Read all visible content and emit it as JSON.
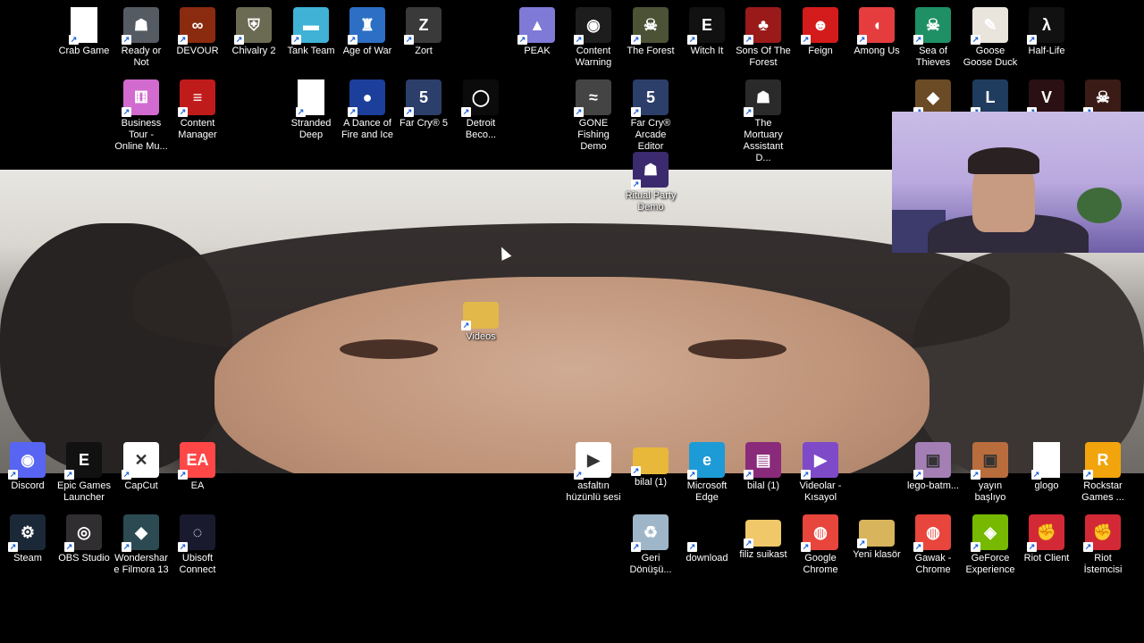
{
  "desktop": {
    "top_row": [
      {
        "label": "Crab Game",
        "icon": "file-icon",
        "color": "#ffffff"
      },
      {
        "label": "Ready or Not",
        "icon": "soldier-icon",
        "color": "#555b63"
      },
      {
        "label": "DEVOUR",
        "icon": "devour-icon",
        "color": "#8a2a0f"
      },
      {
        "label": "Chivalry 2",
        "icon": "shield-icon",
        "color": "#6b6a52"
      },
      {
        "label": "Tank Team",
        "icon": "tank-icon",
        "color": "#3fb2d6"
      },
      {
        "label": "Age of War",
        "icon": "castle-icon",
        "color": "#2c6fc4"
      },
      {
        "label": "Zort",
        "icon": "zort-icon",
        "color": "#3a3a3a"
      },
      {
        "label": "PEAK",
        "icon": "mountain-icon",
        "color": "#7e7ad6"
      },
      {
        "label": "Content Warning",
        "icon": "eye-warning-icon",
        "color": "#1d1d1d"
      },
      {
        "label": "The Forest",
        "icon": "skull-icon",
        "color": "#4c5236"
      },
      {
        "label": "Witch It",
        "icon": "epic-games-icon",
        "color": "#111111"
      },
      {
        "label": "Sons Of The Forest",
        "icon": "forest-icon",
        "color": "#9a1a1a"
      },
      {
        "label": "Feign",
        "icon": "feign-icon",
        "color": "#d41b1b"
      },
      {
        "label": "Among Us",
        "icon": "crewmate-icon",
        "color": "#e53d3d"
      },
      {
        "label": "Sea of Thieves",
        "icon": "skull-icon",
        "color": "#1f8f66"
      },
      {
        "label": "Goose Goose Duck",
        "icon": "goose-icon",
        "color": "#e9e4dc"
      },
      {
        "label": "Half-Life",
        "icon": "lambda-icon",
        "color": "#111111"
      }
    ],
    "second_row": [
      {
        "label": "Business Tour - Online Mu...",
        "icon": "dice-icon",
        "color": "#d26bd0"
      },
      {
        "label": "Content Manager",
        "icon": "cm-icon",
        "color": "#c01b1b"
      },
      {
        "label": "Stranded Deep",
        "icon": "file-icon",
        "color": "#ffffff"
      },
      {
        "label": "A Dance of Fire and Ice",
        "icon": "planets-icon",
        "color": "#1b3f9a"
      },
      {
        "label": "Far Cry® 5",
        "icon": "farcry-icon",
        "color": "#2c3e6a"
      },
      {
        "label": "Detroit Beco...",
        "icon": "ring-icon",
        "color": "#0b0b0b"
      },
      {
        "label": "GONE Fishing Demo",
        "icon": "fish-icon",
        "color": "#444444"
      },
      {
        "label": "Far Cry® Arcade Editor",
        "icon": "farcry-icon",
        "color": "#2c3e6a"
      },
      {
        "label": "The Mortuary Assistant D...",
        "icon": "mortuary-icon",
        "color": "#2a2a2a"
      }
    ],
    "extra_row2_icons": [
      {
        "icon": "hearthstone-icon",
        "color": "#6b4a26"
      },
      {
        "icon": "league-icon",
        "color": "#1f3b5e"
      },
      {
        "icon": "valorant-icon",
        "color": "#2a0f13"
      },
      {
        "icon": "horror-icon",
        "color": "#3a1b16"
      }
    ],
    "ritual_party": {
      "label": "Ritual Party Demo",
      "icon": "hooded-figure-icon",
      "color": "#3b2a6e"
    },
    "videos": {
      "label": "Videos",
      "icon": "folder-icon",
      "color": "#e2b84a"
    },
    "left_bottom_row1": [
      {
        "label": "Discord",
        "icon": "discord-icon",
        "color": "#5865f2"
      },
      {
        "label": "Epic Games Launcher",
        "icon": "epic-games-icon",
        "color": "#111111"
      },
      {
        "label": "CapCut",
        "icon": "capcut-icon",
        "color": "#ffffff"
      },
      {
        "label": "EA",
        "icon": "ea-icon",
        "color": "#ff4747"
      }
    ],
    "left_bottom_row2": [
      {
        "label": "Steam",
        "icon": "steam-icon",
        "color": "#1b2838"
      },
      {
        "label": "OBS Studio",
        "icon": "obs-icon",
        "color": "#302e31"
      },
      {
        "label": "Wondershare Filmora 13",
        "icon": "filmora-icon",
        "color": "#2c4a52"
      },
      {
        "label": "Ubisoft Connect",
        "icon": "ubisoft-icon",
        "color": "#1a1a2e"
      }
    ],
    "right_bottom_row1": [
      {
        "label": "asfaltın hüzünlü sesi",
        "icon": "video-file-icon",
        "color": "#ffffff"
      },
      {
        "label": "bilal (1)",
        "icon": "folder-icon",
        "color": "#e8b83b"
      },
      {
        "label": "Microsoft Edge",
        "icon": "edge-icon",
        "color": "#1d9bd6"
      },
      {
        "label": "bilal (1)",
        "icon": "winrar-icon",
        "color": "#8a2a7a"
      },
      {
        "label": "Videolar - Kısayol",
        "icon": "video-folder-icon",
        "color": "#7e4ac8"
      },
      {
        "label": "lego-batm...",
        "icon": "image-file-icon",
        "color": "#a47fb5"
      },
      {
        "label": "yayın başlıyo",
        "icon": "image-file-icon",
        "color": "#b96d3d"
      },
      {
        "label": "glogo",
        "icon": "file-icon",
        "color": "#ffffff"
      },
      {
        "label": "Rockstar Games ...",
        "icon": "rockstar-icon",
        "color": "#f2a40c"
      }
    ],
    "right_bottom_row2": [
      {
        "label": "Geri Dönüşü...",
        "icon": "recycle-bin-icon",
        "color": "#9fb6c9"
      },
      {
        "label": "download",
        "icon": "blank-icon",
        "color": "#000000"
      },
      {
        "label": "filiz suikast",
        "icon": "folder-icon",
        "color": "#f0c869"
      },
      {
        "label": "Google Chrome",
        "icon": "chrome-icon",
        "color": "#e8453c"
      },
      {
        "label": "Yeni klasör",
        "icon": "folder-icon",
        "color": "#d8b45c"
      },
      {
        "label": "Gawak - Chrome",
        "icon": "chrome-icon",
        "color": "#e8453c"
      },
      {
        "label": "GeForce Experience",
        "icon": "nvidia-icon",
        "color": "#76b900"
      },
      {
        "label": "Riot Client",
        "icon": "riot-icon",
        "color": "#d32936"
      },
      {
        "label": "Riot İstemcisi",
        "icon": "riot-icon",
        "color": "#d32936"
      }
    ]
  }
}
